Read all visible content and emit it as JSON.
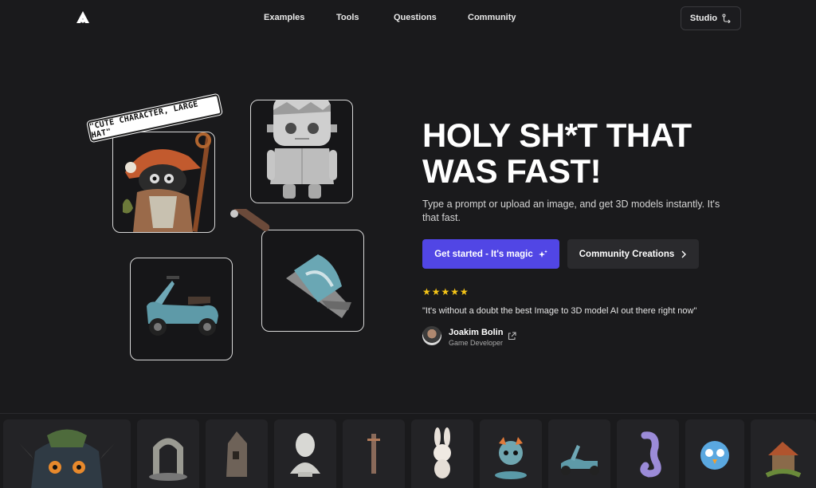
{
  "nav": {
    "logo": "triangle-logo-icon",
    "links": [
      "Examples",
      "Tools",
      "Questions",
      "Community"
    ],
    "studio_label": "Studio",
    "studio_icon": "route-icon"
  },
  "collage": {
    "prompt_tag": "\"CUTE CHARACTER, LARGE HAT\"",
    "items": [
      "wizard-character",
      "frankenstein-toy",
      "scooter",
      "ornate-sword"
    ]
  },
  "hero": {
    "title_line1": "HOLY SH*T THAT",
    "title_line2": "WAS FAST!",
    "subtitle": "Type a prompt or upload an image, and get 3D models instantly. It's that fast.",
    "primary_label": "Get started - It's magic",
    "primary_icon": "sparkles-icon",
    "secondary_label": "Community Creations",
    "secondary_icon": "chevron-right-icon",
    "rating": "★★★★★",
    "quote": "\"It's without a doubt the best Image to 3D model AI out there right now\"",
    "author_name": "Joakim Bolin",
    "author_role": "Game Developer"
  },
  "gallery": {
    "items": [
      "monster-head",
      "stone-arch",
      "wooden-tower",
      "marble-bust",
      "sword",
      "bunny",
      "dragon",
      "scooter",
      "seahorse",
      "blue-bird",
      "treehouse"
    ]
  },
  "colors": {
    "background": "#1a1a1c",
    "accent": "#5146e5",
    "star": "#f5c518"
  }
}
